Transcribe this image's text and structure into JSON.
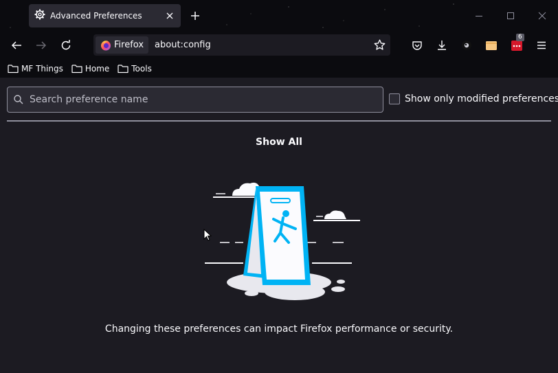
{
  "tab": {
    "title": "Advanced Preferences"
  },
  "urlbar": {
    "identity_label": "Firefox",
    "url": "about:config"
  },
  "toolbar": {
    "extension_badge": "6"
  },
  "bookmarks": [
    {
      "label": "MF Things"
    },
    {
      "label": "Home"
    },
    {
      "label": "Tools"
    }
  ],
  "config": {
    "search_placeholder": "Search preference name",
    "modified_label": "Show only modified preferences",
    "show_all_label": "Show All",
    "warning_text": "Changing these preferences can impact Firefox performance or security."
  },
  "colors": {
    "accent": "#00b3f4",
    "background": "#1c1b22",
    "toolbar": "#0b0b0f",
    "field": "#2b2a33"
  }
}
